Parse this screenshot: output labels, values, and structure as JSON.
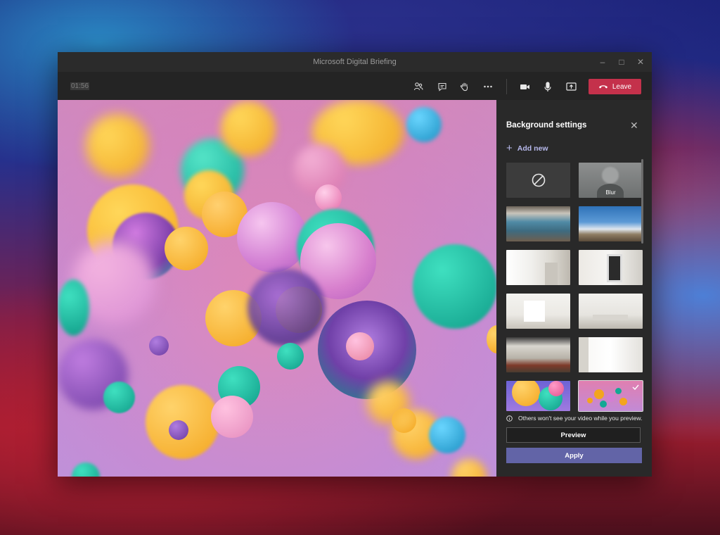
{
  "window": {
    "title": "Microsoft Digital Briefing"
  },
  "toolbar": {
    "timer": "01:56",
    "icons": [
      "participants-icon",
      "chat-icon",
      "raise-hand-icon",
      "more-icon",
      "camera-icon",
      "mic-icon",
      "share-icon"
    ],
    "leave_label": "Leave"
  },
  "panel": {
    "title": "Background settings",
    "add_new_label": "Add new",
    "blur_label": "Blur",
    "note": "Others won't see your video while you preview.",
    "preview_label": "Preview",
    "apply_label": "Apply",
    "selected_index": 11
  },
  "colors": {
    "accent": "#6264a7",
    "leave": "#c4314b",
    "add_new": "#b7b9ec"
  }
}
